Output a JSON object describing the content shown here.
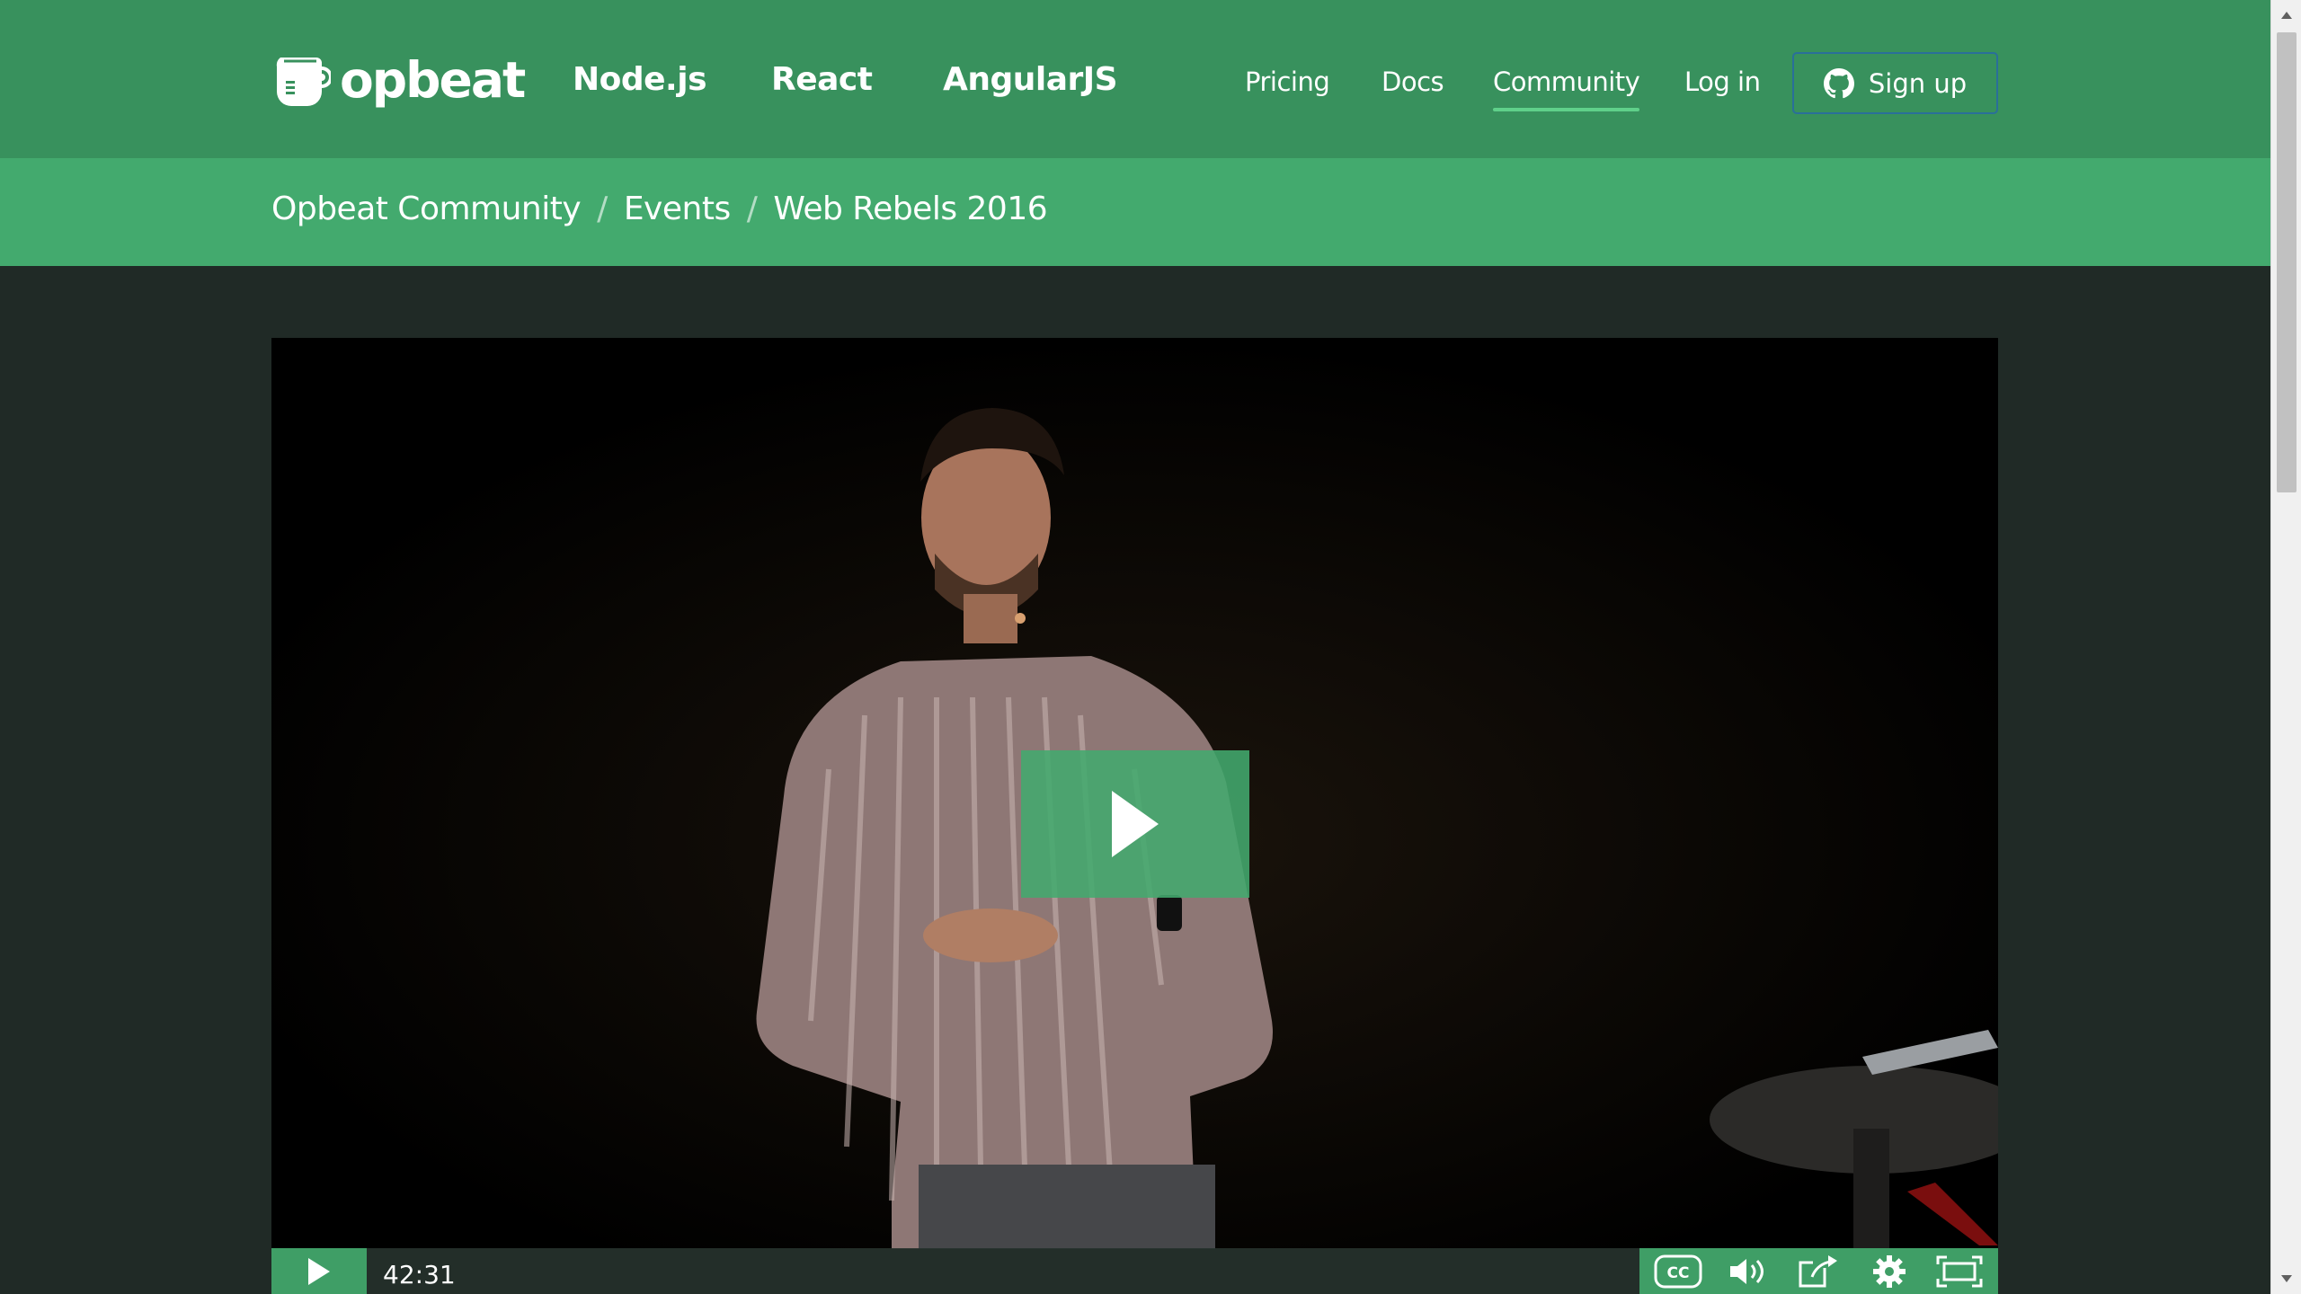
{
  "brand": {
    "name": "opbeat",
    "logo_icon": "coffee-pot-icon"
  },
  "nav": {
    "products": [
      "Node.js",
      "React",
      "AngularJS"
    ],
    "links": [
      {
        "label": "Pricing",
        "active": false
      },
      {
        "label": "Docs",
        "active": false
      },
      {
        "label": "Community",
        "active": true
      },
      {
        "label": "Log in",
        "active": false
      }
    ],
    "signup": {
      "label": "Sign up",
      "icon": "github-icon"
    }
  },
  "breadcrumb": {
    "items": [
      "Opbeat Community",
      "Events",
      "Web Rebels 2016"
    ],
    "separator": "/"
  },
  "video": {
    "duration": "42:31",
    "big_play_icon": "play-icon",
    "controls": [
      "play-icon",
      "cc-icon",
      "volume-icon",
      "share-icon",
      "settings-icon",
      "fullscreen-icon"
    ]
  },
  "colors": {
    "nav_bg": "#38915d",
    "breadcrumb_bg": "#43aa6e",
    "page_bg": "#202a26",
    "accent": "#5fd08a",
    "button_border": "#2a6f9a"
  }
}
